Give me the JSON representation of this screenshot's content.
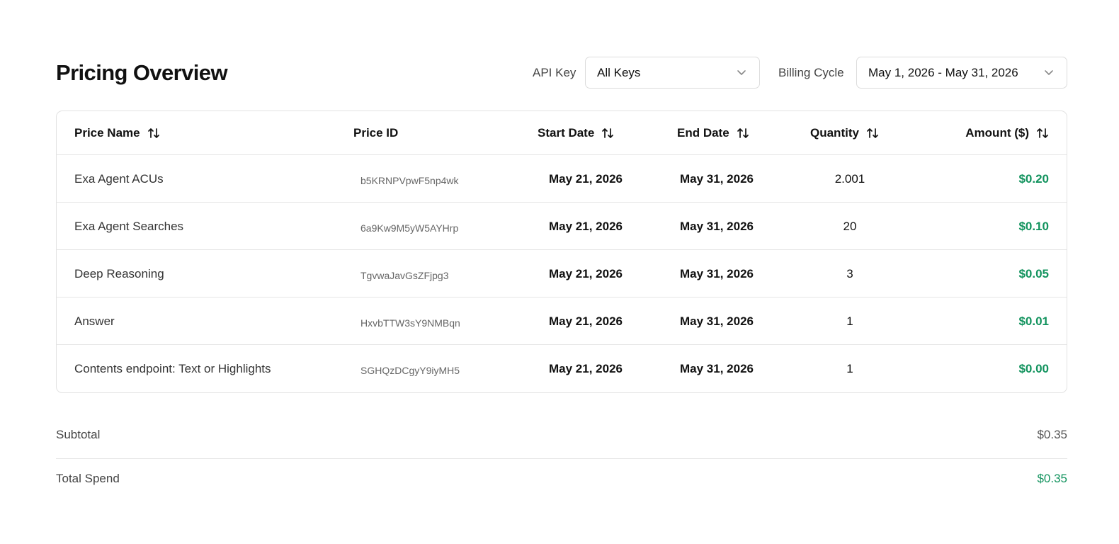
{
  "header": {
    "title": "Pricing Overview",
    "api_key_label": "API Key",
    "api_key_value": "All Keys",
    "billing_cycle_label": "Billing Cycle",
    "billing_cycle_value": "May 1, 2026 - May 31, 2026"
  },
  "table": {
    "columns": {
      "price_name": "Price Name",
      "price_id": "Price ID",
      "start_date": "Start Date",
      "end_date": "End Date",
      "quantity": "Quantity",
      "amount": "Amount ($)"
    },
    "rows": [
      {
        "name": "Exa Agent ACUs",
        "id": "b5KRNPVpwF5np4wk",
        "start": "May 21, 2026",
        "end": "May 31, 2026",
        "quantity": "2.001",
        "amount": "$0.20"
      },
      {
        "name": "Exa Agent Searches",
        "id": "6a9Kw9M5yW5AYHrp",
        "start": "May 21, 2026",
        "end": "May 31, 2026",
        "quantity": "20",
        "amount": "$0.10"
      },
      {
        "name": "Deep Reasoning",
        "id": "TgvwaJavGsZFjpg3",
        "start": "May 21, 2026",
        "end": "May 31, 2026",
        "quantity": "3",
        "amount": "$0.05"
      },
      {
        "name": "Answer",
        "id": "HxvbTTW3sY9NMBqn",
        "start": "May 21, 2026",
        "end": "May 31, 2026",
        "quantity": "1",
        "amount": "$0.01"
      },
      {
        "name": "Contents endpoint: Text or Highlights",
        "id": "SGHQzDCgyY9iyMH5",
        "start": "May 21, 2026",
        "end": "May 31, 2026",
        "quantity": "1",
        "amount": "$0.00"
      }
    ]
  },
  "summary": {
    "subtotal_label": "Subtotal",
    "subtotal_value": "$0.35",
    "total_label": "Total Spend",
    "total_value": "$0.35"
  },
  "colors": {
    "amount_green": "#12935e",
    "border": "#e2e2e2"
  },
  "icons": {
    "sort": "sort-arrows-icon",
    "dropdown": "chevron-down-icon"
  }
}
